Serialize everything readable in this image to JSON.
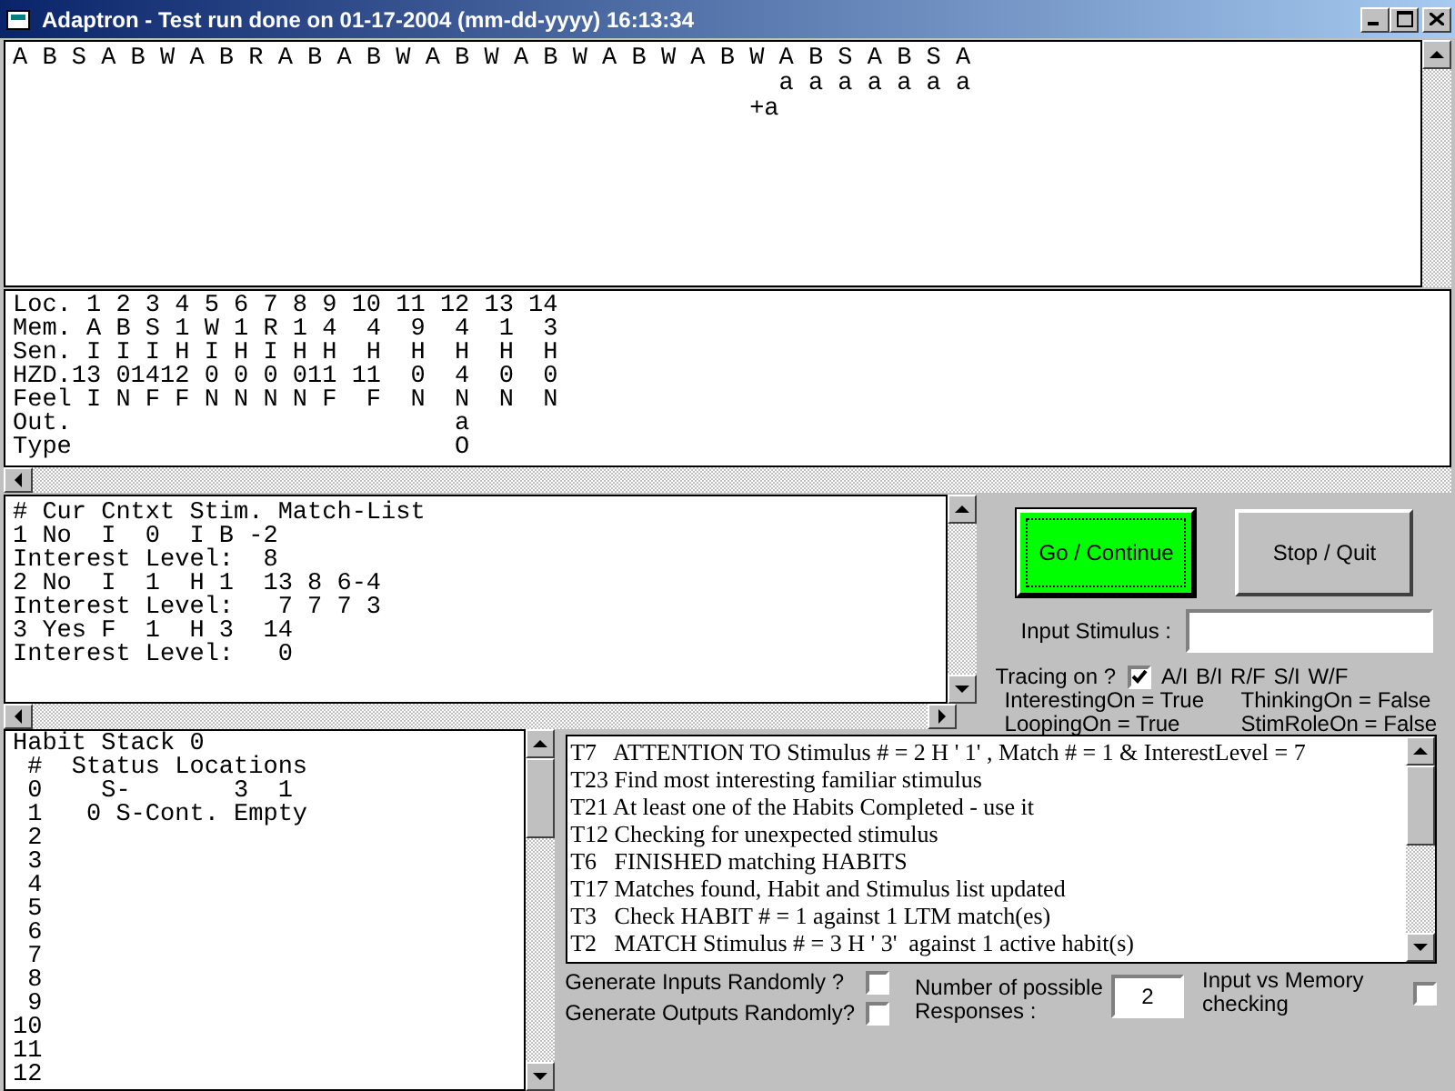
{
  "window": {
    "title": "Adaptron - Test run done on 01-17-2004 (mm-dd-yyyy) 16:13:34"
  },
  "sequence_pane": {
    "lines": [
      "A B S A B W A B R A B A B W A B W A B W A B W A B W A B S A B S A",
      "                                                    a a a a a a a",
      "                                                  +a"
    ]
  },
  "memory_pane": {
    "lines": [
      "Loc. 1 2 3 4 5 6 7 8 9 10 11 12 13 14",
      "Mem. A B S 1 W 1 R 1 4  4  9  4  1  3",
      "Sen. I I I H I H I H H  H  H  H  H  H",
      "HZD.13 01412 0 0 0 011 11  0  4  0  0",
      "Feel I N F F N N N N F  F  N  N  N  N",
      "Out.                          a",
      "Type                          O"
    ]
  },
  "match_pane": {
    "lines": [
      "# Cur Cntxt Stim. Match-List",
      "1 No  I  0  I B -2",
      "Interest Level:  8",
      "2 No  I  1  H 1  13 8 6-4",
      "Interest Level:   7 7 7 3",
      "3 Yes F  1  H 3  14",
      "Interest Level:   0"
    ]
  },
  "buttons": [
    {
      "label": "Go / Continue",
      "kind": "go",
      "focused": true
    },
    {
      "label": "Stop / Quit",
      "kind": "stop",
      "focused": false
    }
  ],
  "input_stimulus": {
    "label": "Input Stimulus :"
  },
  "tracing": {
    "label": "Tracing on ?",
    "checked": true,
    "filters": "A/I  B/I  R/F  S/I  W/F"
  },
  "flags": [
    "InterestingOn = True",
    "ThinkingOn = False",
    "LoopingOn = True",
    "StimRoleOn = False"
  ],
  "habit_pane": {
    "lines": [
      "Habit Stack 0",
      " #  Status Locations",
      " 0    S-       3  1",
      " 1   0 S-Cont. Empty",
      " 2",
      " 3",
      " 4",
      " 5",
      " 6",
      " 7",
      " 8",
      " 9",
      "10",
      "11",
      "12"
    ]
  },
  "trace_list": {
    "lines": [
      "T7   ATTENTION TO Stimulus # = 2 H ' 1' , Match # = 1 & InterestLevel = 7",
      "T23 Find most interesting familiar stimulus",
      "T21 At least one of the Habits Completed - use it",
      "T12 Checking for unexpected stimulus",
      "T6   FINISHED matching HABITS",
      "T17 Matches found, Habit and Stimulus list updated",
      "T3   Check HABIT # = 1 against 1 LTM match(es)",
      "T2   MATCH Stimulus # = 3 H ' 3'  against 1 active habit(s)"
    ]
  },
  "options": [
    {
      "label": "Generate Inputs Randomly ?",
      "checked": false
    },
    {
      "label": "Generate Outputs Randomly?",
      "checked": false
    }
  ],
  "responses": {
    "label": "Number of possible Responses :",
    "value": "2"
  },
  "memory_check": {
    "label": "Input vs Memory checking",
    "checked": false
  }
}
